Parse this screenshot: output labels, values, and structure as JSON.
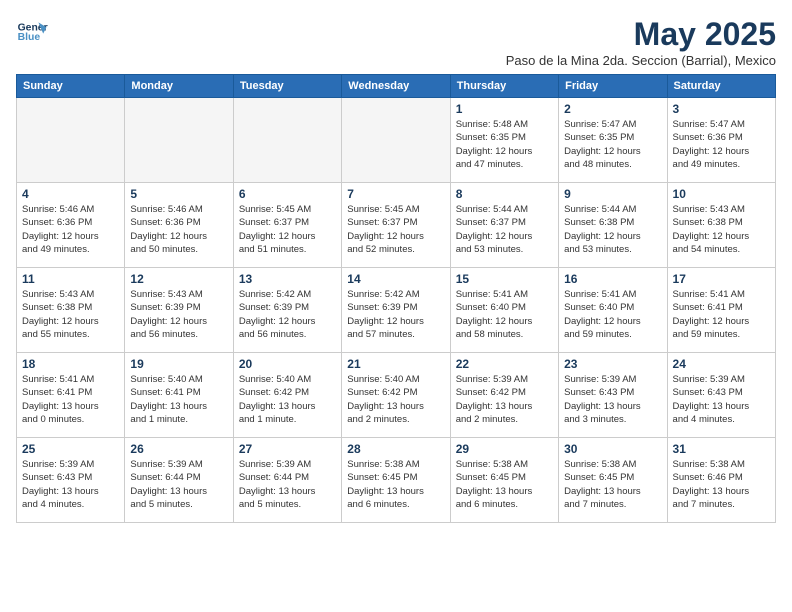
{
  "header": {
    "logo_line1": "General",
    "logo_line2": "Blue",
    "month_title": "May 2025",
    "location": "Paso de la Mina 2da. Seccion (Barrial), Mexico"
  },
  "days_of_week": [
    "Sunday",
    "Monday",
    "Tuesday",
    "Wednesday",
    "Thursday",
    "Friday",
    "Saturday"
  ],
  "weeks": [
    [
      {
        "day": "",
        "info": ""
      },
      {
        "day": "",
        "info": ""
      },
      {
        "day": "",
        "info": ""
      },
      {
        "day": "",
        "info": ""
      },
      {
        "day": "1",
        "info": "Sunrise: 5:48 AM\nSunset: 6:35 PM\nDaylight: 12 hours\nand 47 minutes."
      },
      {
        "day": "2",
        "info": "Sunrise: 5:47 AM\nSunset: 6:35 PM\nDaylight: 12 hours\nand 48 minutes."
      },
      {
        "day": "3",
        "info": "Sunrise: 5:47 AM\nSunset: 6:36 PM\nDaylight: 12 hours\nand 49 minutes."
      }
    ],
    [
      {
        "day": "4",
        "info": "Sunrise: 5:46 AM\nSunset: 6:36 PM\nDaylight: 12 hours\nand 49 minutes."
      },
      {
        "day": "5",
        "info": "Sunrise: 5:46 AM\nSunset: 6:36 PM\nDaylight: 12 hours\nand 50 minutes."
      },
      {
        "day": "6",
        "info": "Sunrise: 5:45 AM\nSunset: 6:37 PM\nDaylight: 12 hours\nand 51 minutes."
      },
      {
        "day": "7",
        "info": "Sunrise: 5:45 AM\nSunset: 6:37 PM\nDaylight: 12 hours\nand 52 minutes."
      },
      {
        "day": "8",
        "info": "Sunrise: 5:44 AM\nSunset: 6:37 PM\nDaylight: 12 hours\nand 53 minutes."
      },
      {
        "day": "9",
        "info": "Sunrise: 5:44 AM\nSunset: 6:38 PM\nDaylight: 12 hours\nand 53 minutes."
      },
      {
        "day": "10",
        "info": "Sunrise: 5:43 AM\nSunset: 6:38 PM\nDaylight: 12 hours\nand 54 minutes."
      }
    ],
    [
      {
        "day": "11",
        "info": "Sunrise: 5:43 AM\nSunset: 6:38 PM\nDaylight: 12 hours\nand 55 minutes."
      },
      {
        "day": "12",
        "info": "Sunrise: 5:43 AM\nSunset: 6:39 PM\nDaylight: 12 hours\nand 56 minutes."
      },
      {
        "day": "13",
        "info": "Sunrise: 5:42 AM\nSunset: 6:39 PM\nDaylight: 12 hours\nand 56 minutes."
      },
      {
        "day": "14",
        "info": "Sunrise: 5:42 AM\nSunset: 6:39 PM\nDaylight: 12 hours\nand 57 minutes."
      },
      {
        "day": "15",
        "info": "Sunrise: 5:41 AM\nSunset: 6:40 PM\nDaylight: 12 hours\nand 58 minutes."
      },
      {
        "day": "16",
        "info": "Sunrise: 5:41 AM\nSunset: 6:40 PM\nDaylight: 12 hours\nand 59 minutes."
      },
      {
        "day": "17",
        "info": "Sunrise: 5:41 AM\nSunset: 6:41 PM\nDaylight: 12 hours\nand 59 minutes."
      }
    ],
    [
      {
        "day": "18",
        "info": "Sunrise: 5:41 AM\nSunset: 6:41 PM\nDaylight: 13 hours\nand 0 minutes."
      },
      {
        "day": "19",
        "info": "Sunrise: 5:40 AM\nSunset: 6:41 PM\nDaylight: 13 hours\nand 1 minute."
      },
      {
        "day": "20",
        "info": "Sunrise: 5:40 AM\nSunset: 6:42 PM\nDaylight: 13 hours\nand 1 minute."
      },
      {
        "day": "21",
        "info": "Sunrise: 5:40 AM\nSunset: 6:42 PM\nDaylight: 13 hours\nand 2 minutes."
      },
      {
        "day": "22",
        "info": "Sunrise: 5:39 AM\nSunset: 6:42 PM\nDaylight: 13 hours\nand 2 minutes."
      },
      {
        "day": "23",
        "info": "Sunrise: 5:39 AM\nSunset: 6:43 PM\nDaylight: 13 hours\nand 3 minutes."
      },
      {
        "day": "24",
        "info": "Sunrise: 5:39 AM\nSunset: 6:43 PM\nDaylight: 13 hours\nand 4 minutes."
      }
    ],
    [
      {
        "day": "25",
        "info": "Sunrise: 5:39 AM\nSunset: 6:43 PM\nDaylight: 13 hours\nand 4 minutes."
      },
      {
        "day": "26",
        "info": "Sunrise: 5:39 AM\nSunset: 6:44 PM\nDaylight: 13 hours\nand 5 minutes."
      },
      {
        "day": "27",
        "info": "Sunrise: 5:39 AM\nSunset: 6:44 PM\nDaylight: 13 hours\nand 5 minutes."
      },
      {
        "day": "28",
        "info": "Sunrise: 5:38 AM\nSunset: 6:45 PM\nDaylight: 13 hours\nand 6 minutes."
      },
      {
        "day": "29",
        "info": "Sunrise: 5:38 AM\nSunset: 6:45 PM\nDaylight: 13 hours\nand 6 minutes."
      },
      {
        "day": "30",
        "info": "Sunrise: 5:38 AM\nSunset: 6:45 PM\nDaylight: 13 hours\nand 7 minutes."
      },
      {
        "day": "31",
        "info": "Sunrise: 5:38 AM\nSunset: 6:46 PM\nDaylight: 13 hours\nand 7 minutes."
      }
    ]
  ]
}
